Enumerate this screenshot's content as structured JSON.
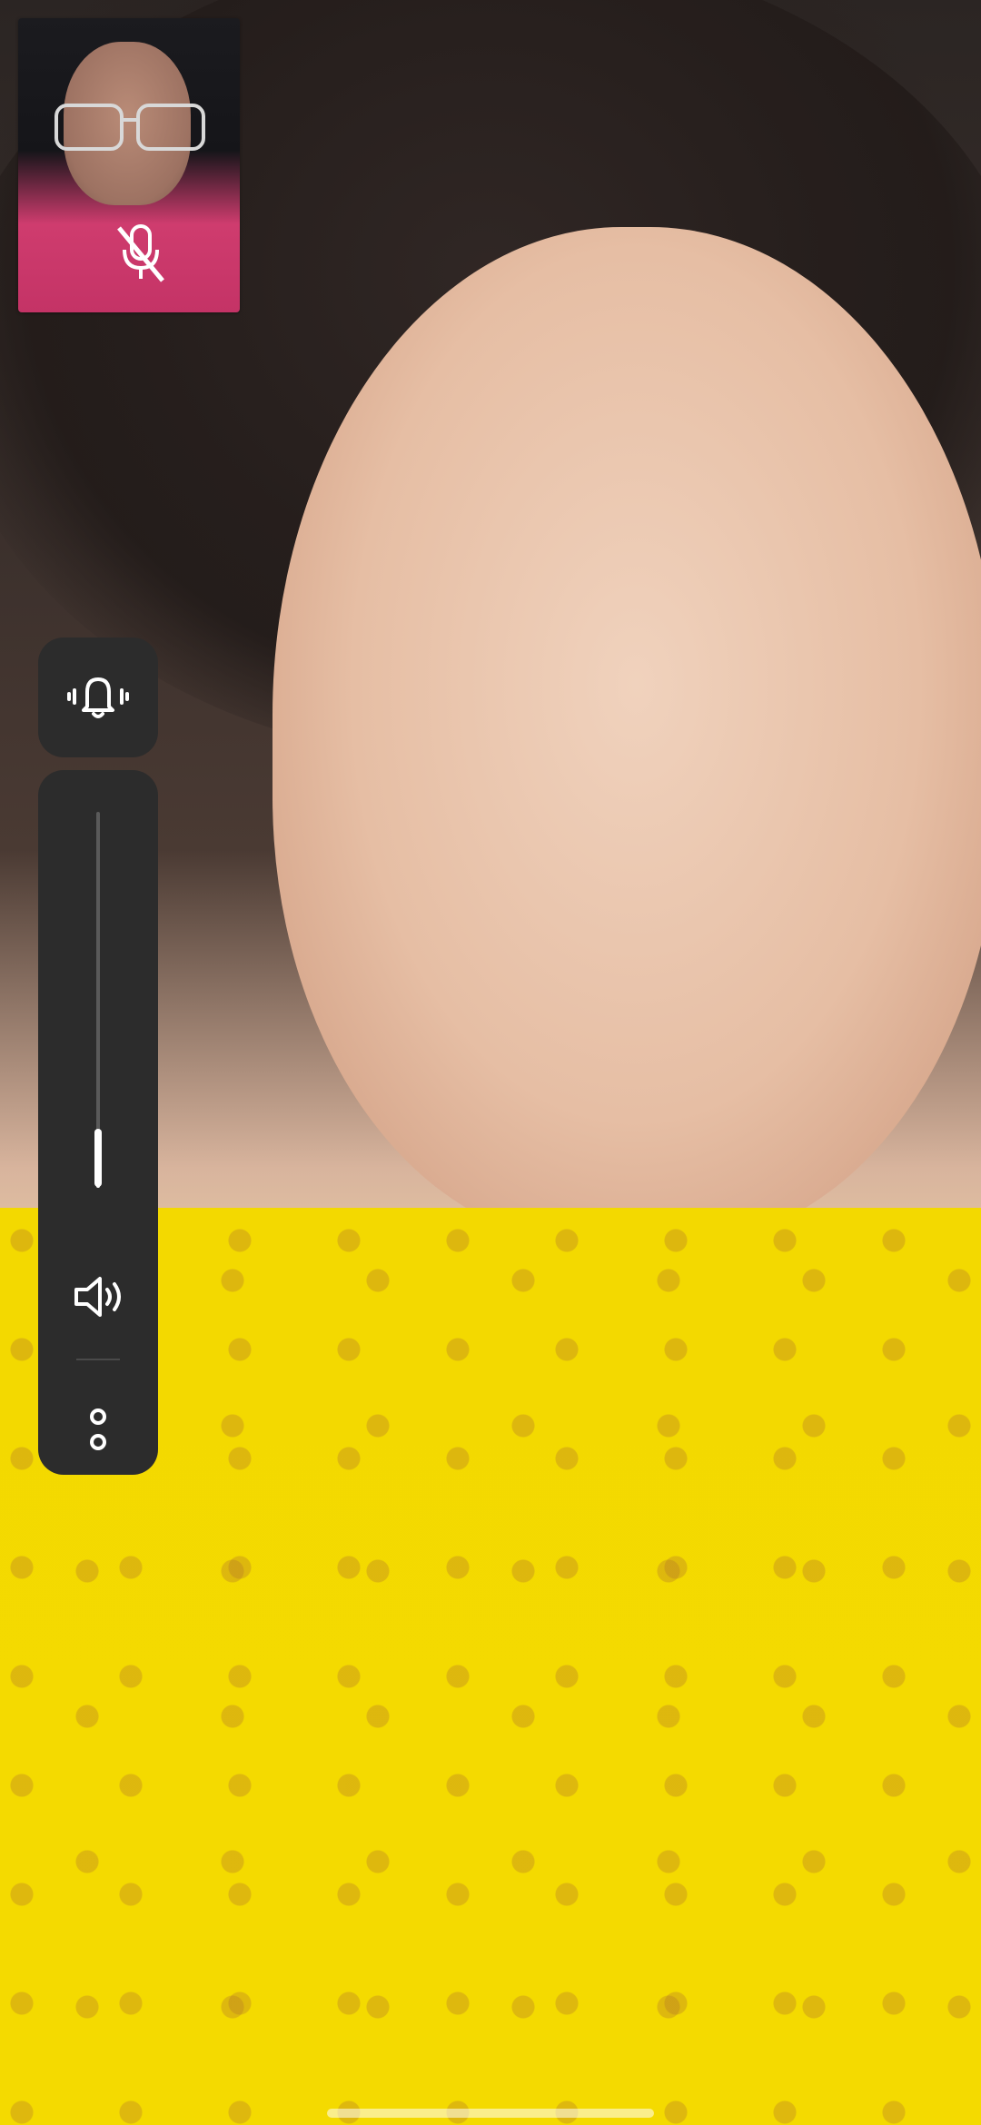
{
  "app": {
    "screen": "video-call"
  },
  "remote_video": {
    "colors": {
      "hair": "#2f2624",
      "skin": "#e6bea4",
      "clothing": "#f3d900"
    }
  },
  "self_preview": {
    "muted": true,
    "icon": "mic-off-icon",
    "colors": {
      "shirt": "#c43366",
      "background": "#1b1b1f"
    }
  },
  "controls": {
    "ring_mode": {
      "icon": "bell-vibrate-icon"
    },
    "volume": {
      "level_percent": 8,
      "icon": "speaker-icon"
    },
    "more": {
      "icon": "more-options-icon"
    },
    "panel_color": "#2c2c2c"
  }
}
